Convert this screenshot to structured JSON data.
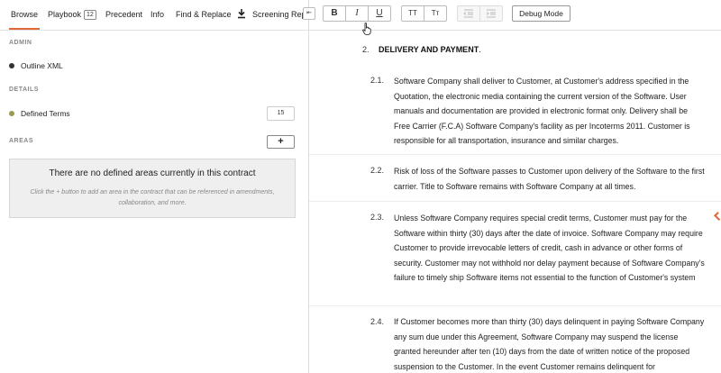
{
  "tabs": [
    {
      "label": "Browse",
      "active": true
    },
    {
      "label": "Playbook",
      "badge": "12"
    },
    {
      "label": "Precedent"
    },
    {
      "label": "Info"
    },
    {
      "label": "Find & Replace"
    },
    {
      "label": "Screening Repor"
    }
  ],
  "collapse_label": "⇤",
  "sections": {
    "admin": "ADMIN",
    "details": "DETAILS",
    "areas": "AREAS"
  },
  "admin_item": {
    "label": "Outline XML",
    "dot_color": "#333333"
  },
  "details_item": {
    "label": "Defined Terms",
    "count": "15",
    "dot_color": "#9a9a52"
  },
  "areas": {
    "add_label": "+",
    "empty_title": "There are no defined areas currently in this contract",
    "empty_hint": "Click the + button to add an area in the contract that can be referenced in amendments, collaboration, and more."
  },
  "toolbar": {
    "bold": "B",
    "italic": "I",
    "underline": "U",
    "uppercase": "TT",
    "titlecase": "Tт",
    "debug": "Debug Mode"
  },
  "document": {
    "section_number": "2.",
    "section_title": "DELIVERY AND PAYMENT",
    "section_title_suffix": ".",
    "clauses": [
      {
        "number": "2.1.",
        "text": "Software Company shall deliver to Customer, at Customer's address specified in the Quotation, the electronic media containing the current version of the Software.  User manuals and documentation are provided in electronic format only.  Delivery shall be Free Carrier (F.C.A) Software Company's facility as per Incoterms 2011.  Customer is responsible for all transportation, insurance and similar charges."
      },
      {
        "number": "2.2.",
        "text": "Risk of loss of the Software passes to Customer upon delivery of the Software to the first carrier.  Title to Software remains with Software Company at all times."
      },
      {
        "number": "2.3.",
        "text": "Unless Software Company requires special credit terms, Customer must pay for the Software within thirty (30) days after the date of invoice.  Software Company may require Customer to provide irrevocable letters of credit, cash in advance or other forms of security.  Customer may not withhold nor delay payment because of Software Company's failure to timely ship Software items not essential to the function of Customer's system"
      },
      {
        "number": "2.4.",
        "text": "If Customer becomes more than thirty (30) days delinquent in paying Software Company any sum due under this Agreement, Software Company may suspend the license granted hereunder after ten (10) days from the date of written notice of the proposed suspension to the Customer.  In the event Customer remains delinquent for"
      }
    ]
  }
}
